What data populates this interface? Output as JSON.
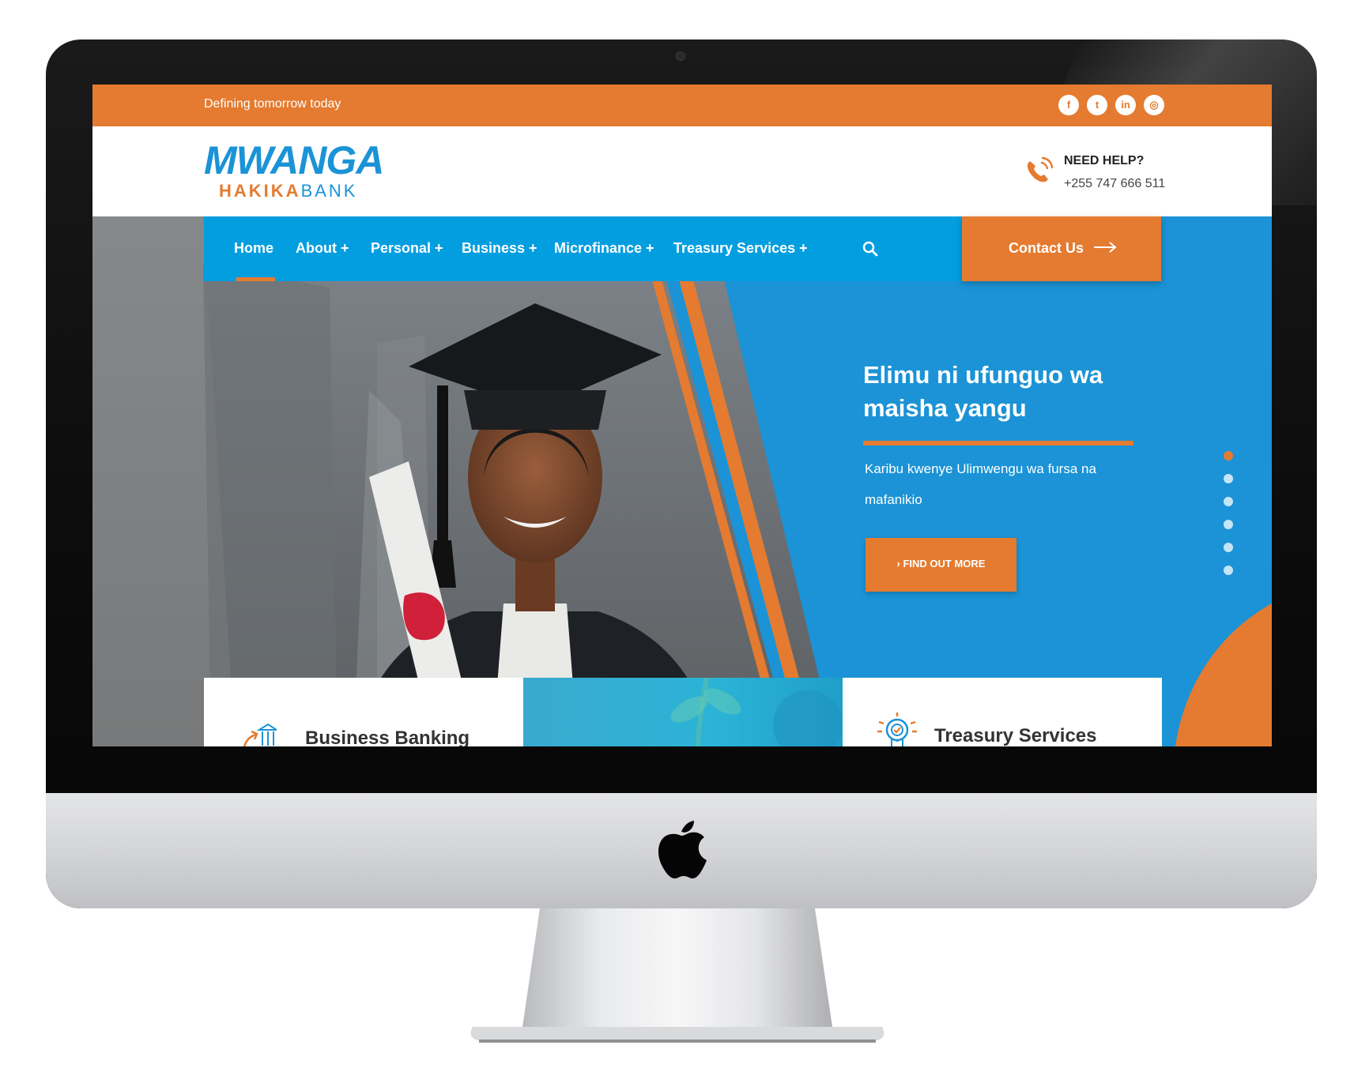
{
  "topbar": {
    "tagline": "Defining tomorrow today",
    "social": [
      {
        "icon": "facebook-icon",
        "glyph": "f"
      },
      {
        "icon": "twitter-icon",
        "glyph": "t"
      },
      {
        "icon": "linkedin-icon",
        "glyph": "in"
      },
      {
        "icon": "instagram-icon",
        "glyph": "◎"
      }
    ]
  },
  "header": {
    "logo_main": "MWANGA",
    "logo_sub_a": "HAKIKA",
    "logo_sub_b": "BANK",
    "help_title": "NEED HELP?",
    "help_phone": "+255 747 666 511"
  },
  "nav": {
    "items": [
      "Home",
      "About +",
      "Personal +",
      "Business +",
      "Microfinance +",
      "Treasury Services +"
    ],
    "active": "Home",
    "contact_label": "Contact Us"
  },
  "hero": {
    "title": "Elimu ni ufunguo wa maisha yangu",
    "text": "Karibu kwenye Ulimwengu wa fursa na mafanikio",
    "cta_label": "› FIND OUT MORE",
    "slide_count": 6,
    "active_slide": 1
  },
  "cards": {
    "left_title": "Business Banking",
    "right_title": "Treasury Services"
  },
  "colors": {
    "orange": "#e47b30",
    "blue": "#1b93d6",
    "nav_blue": "#039ee0"
  }
}
